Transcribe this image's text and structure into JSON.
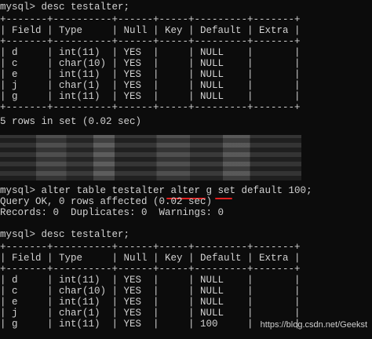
{
  "session1": {
    "prompt_line": "mysql> desc testalter;",
    "table_border": "+-------+----------+------+-----+---------+-------+",
    "header_row": "| Field | Type     | Null | Key | Default | Extra |",
    "rows": [
      "| d     | int(11)  | YES  |     | NULL    |       |",
      "| c     | char(10) | YES  |     | NULL    |       |",
      "| e     | int(11)  | YES  |     | NULL    |       |",
      "| j     | char(1)  | YES  |     | NULL    |       |",
      "| g     | int(11)  | YES  |     | NULL    |       |"
    ],
    "result_line": "5 rows in set (0.02 sec)"
  },
  "alter_command": {
    "prompt_line": "mysql> alter table testalter alter g set default 100;",
    "query_ok": "Query OK, 0 rows affected (0.02 sec)",
    "records": "Records: 0  Duplicates: 0  Warnings: 0"
  },
  "session2": {
    "prompt_line": "mysql> desc testalter;",
    "table_border": "+-------+----------+------+-----+---------+-------+",
    "header_row": "| Field | Type     | Null | Key | Default | Extra |",
    "rows": [
      "| d     | int(11)  | YES  |     | NULL    |       |",
      "| c     | char(10) | YES  |     | NULL    |       |",
      "| e     | int(11)  | YES  |     | NULL    |       |",
      "| j     | char(1)  | YES  |     | NULL    |       |",
      "| g     | int(11)  | YES  |     | 100     |       |"
    ]
  },
  "watermark": "https://blog.csdn.net/Geekst",
  "colors": {
    "background": "#0c0c0c",
    "text": "#d2d2d2",
    "annotation": "#e02020"
  }
}
